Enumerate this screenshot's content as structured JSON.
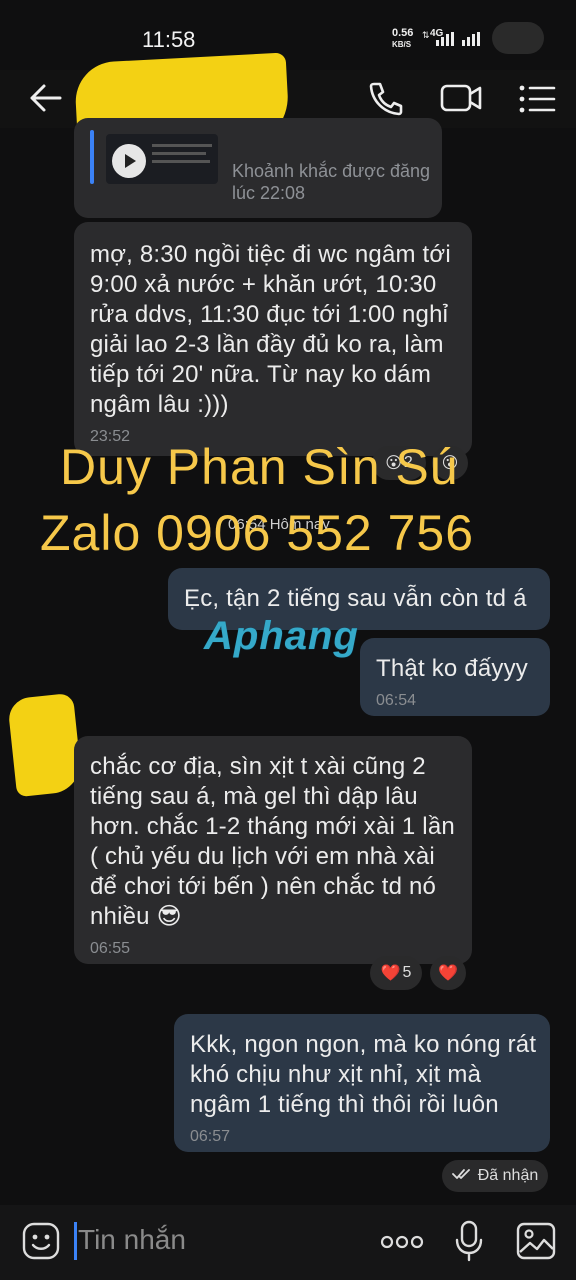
{
  "status_bar": {
    "time": "11:58",
    "speed_value": "0.56",
    "speed_unit": "KB/S",
    "network": "4G"
  },
  "shared_post": {
    "caption": "Khoảnh khắc được đăng lúc 22:08"
  },
  "messages": [
    {
      "id": "m1",
      "direction": "incoming",
      "text": "mợ, 8:30 ngồi tiệc đi wc ngâm tới 9:00 xả nước + khăn ướt, 10:30 rửa ddvs, 11:30 đục tới 1:00 nghỉ giải lao 2-3 lần đầy đủ ko ra, làm tiếp tới 20' nữa. Từ nay ko dám ngâm lâu :)))",
      "time": "23:52",
      "reactions": {
        "count": "2",
        "emoji": "😮"
      }
    },
    {
      "id": "m2",
      "direction": "outgoing",
      "text": "Ẹc, tận 2 tiếng sau vẫn còn td á",
      "time": ""
    },
    {
      "id": "m3",
      "direction": "outgoing",
      "text": "Thật ko đấyyy",
      "time": "06:54"
    },
    {
      "id": "m4",
      "direction": "incoming",
      "text": "chắc cơ địa, sìn xịt t xài cũng 2 tiếng sau á, mà gel thì dập lâu hơn. chắc 1-2 tháng mới xài 1 lần ( chủ yếu du lịch với em nhà xài để chơi tới bến ) nên chắc td nó nhiều 😎",
      "time": "06:55",
      "reactions": {
        "count": "5",
        "emoji": "❤️"
      }
    },
    {
      "id": "m5",
      "direction": "outgoing",
      "text": "Kkk, ngon ngon, mà ko nóng rát khó chịu như xịt nhỉ, xịt mà ngâm 1 tiếng thì thôi rồi luôn",
      "time": "06:57"
    }
  ],
  "date_separator": "06:54 Hôm nay",
  "delivery_status": "Đã nhận",
  "watermark": {
    "line1": "Duy Phan Sìn Sú",
    "line2": "Zalo 0906 552 756",
    "brand": "Aphang"
  },
  "composer": {
    "placeholder": "Tin nhắn"
  },
  "icons": {
    "back": "arrow-left-icon",
    "call": "phone-icon",
    "video": "video-camera-icon",
    "menu": "list-menu-icon",
    "emoji": "emoji-icon",
    "more": "more-dots-icon",
    "mic": "microphone-icon",
    "image": "image-icon"
  },
  "colors": {
    "background": "#0f0f10",
    "incoming_bubble": "#2b2b2d",
    "outgoing_bubble": "#2c3847",
    "accent_blue": "#3b82f6",
    "watermark": "#f6c84a",
    "redaction": "#f3d114"
  }
}
